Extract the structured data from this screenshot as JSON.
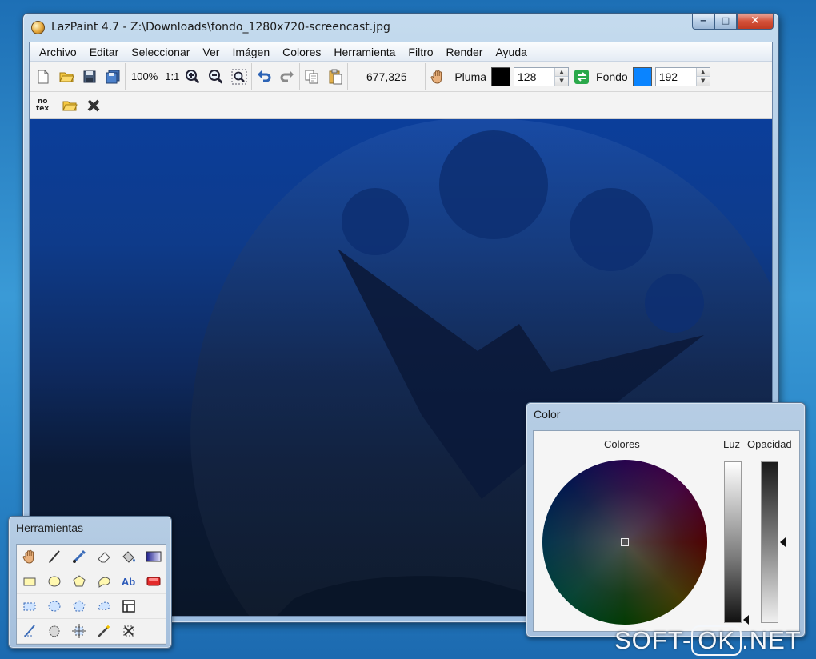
{
  "window": {
    "title": "LazPaint 4.7 - Z:\\Downloads\\fondo_1280x720-screencast.jpg",
    "minimize_glyph": "‒",
    "maximize_glyph": "□",
    "close_glyph": "✕"
  },
  "menu": [
    "Archivo",
    "Editar",
    "Seleccionar",
    "Ver",
    "Imágen",
    "Colores",
    "Herramienta",
    "Filtro",
    "Render",
    "Ayuda"
  ],
  "toolbar": {
    "zoom_level": "100%",
    "zoom_one_to_one": "1:1",
    "coordinates": "677,325",
    "pen_label": "Pluma",
    "pen_color": "#000000",
    "pen_alpha": "128",
    "back_label": "Fondo",
    "back_color": "#0a84ff",
    "back_alpha": "192"
  },
  "toolbar2": {
    "notex_label_top": "no",
    "notex_label_bottom": "tex"
  },
  "icons": {
    "new": "new-file-icon",
    "open": "open-folder-icon",
    "save": "save-icon",
    "save_as": "save-as-icon",
    "zoom_in": "zoom-in-icon",
    "zoom_out": "zoom-out-icon",
    "zoom_fit": "zoom-fit-icon",
    "undo": "undo-icon",
    "redo": "redo-icon",
    "copy": "copy-icon",
    "paste": "paste-icon",
    "hand": "hand-icon",
    "swap": "swap-colors-icon"
  },
  "tools_panel": {
    "title": "Herramientas",
    "text_tool_label": "Ab"
  },
  "color_panel": {
    "title": "Color",
    "colors_label": "Colores",
    "light_label": "Luz",
    "opacity_label": "Opacidad",
    "light_level": 0.98,
    "opacity_level": 0.5
  },
  "watermark": {
    "left": "SOFT-",
    "middle": "OK",
    "right": ".NET"
  }
}
